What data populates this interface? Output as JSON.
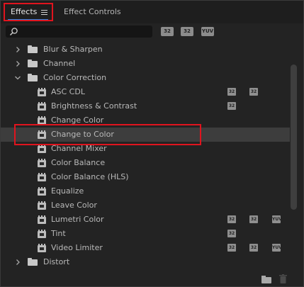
{
  "tabs": {
    "effects": "Effects",
    "effect_controls": "Effect Controls"
  },
  "search": {
    "value": "",
    "placeholder": ""
  },
  "filters": [
    "32",
    "32",
    "YUV"
  ],
  "tree": [
    {
      "label": "Blur & Sharpen",
      "kind": "folder",
      "expanded": false
    },
    {
      "label": "Channel",
      "kind": "folder",
      "expanded": false
    },
    {
      "label": "Color Correction",
      "kind": "folder",
      "expanded": true
    },
    {
      "label": "ASC CDL",
      "kind": "effect",
      "badges": [
        "32",
        "32"
      ]
    },
    {
      "label": "Brightness & Contrast",
      "kind": "effect",
      "badges": [
        "32"
      ]
    },
    {
      "label": "Change Color",
      "kind": "effect",
      "badges": []
    },
    {
      "label": "Change to Color",
      "kind": "effect",
      "badges": [],
      "selected": true
    },
    {
      "label": "Channel Mixer",
      "kind": "effect",
      "badges": []
    },
    {
      "label": "Color Balance",
      "kind": "effect",
      "badges": []
    },
    {
      "label": "Color Balance (HLS)",
      "kind": "effect",
      "badges": []
    },
    {
      "label": "Equalize",
      "kind": "effect",
      "badges": []
    },
    {
      "label": "Leave Color",
      "kind": "effect",
      "badges": []
    },
    {
      "label": "Lumetri Color",
      "kind": "effect",
      "badges": [
        "32",
        "32",
        "YUV"
      ]
    },
    {
      "label": "Tint",
      "kind": "effect",
      "badges": [
        "32"
      ]
    },
    {
      "label": "Video Limiter",
      "kind": "effect",
      "badges": [
        "32",
        "32",
        "YUV"
      ]
    },
    {
      "label": "Distort",
      "kind": "folder",
      "expanded": false
    }
  ],
  "colors": {
    "highlight": "#e0141e",
    "tab_underline": "#2d8ceb",
    "selected_row": "#3d3d3d",
    "panel_bg": "#232323"
  },
  "icons": {
    "menu": "hamburger-icon",
    "search": "search-icon",
    "folder": "folder-icon",
    "effect": "effect-icon",
    "new_bin": "new-bin-icon",
    "delete": "trash-icon"
  }
}
